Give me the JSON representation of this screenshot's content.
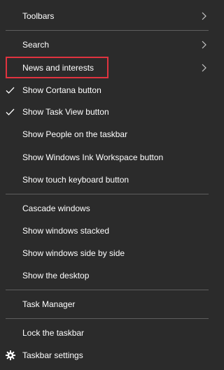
{
  "menu": {
    "items": [
      {
        "label": "Toolbars"
      },
      {
        "label": "Search"
      },
      {
        "label": "News and interests"
      },
      {
        "label": "Show Cortana button"
      },
      {
        "label": "Show Task View button"
      },
      {
        "label": "Show People on the taskbar"
      },
      {
        "label": "Show Windows Ink Workspace button"
      },
      {
        "label": "Show touch keyboard button"
      },
      {
        "label": "Cascade windows"
      },
      {
        "label": "Show windows stacked"
      },
      {
        "label": "Show windows side by side"
      },
      {
        "label": "Show the desktop"
      },
      {
        "label": "Task Manager"
      },
      {
        "label": "Lock the taskbar"
      },
      {
        "label": "Taskbar settings"
      }
    ]
  },
  "colors": {
    "background": "#2b2b2b",
    "text": "#ffffff",
    "separator": "#5e5e5e",
    "highlight_border": "#e0333f",
    "check_color": "#ffffff"
  },
  "icons": {
    "checkmark": "check-icon",
    "submenu": "chevron-right-icon",
    "settings": "gear-icon"
  }
}
